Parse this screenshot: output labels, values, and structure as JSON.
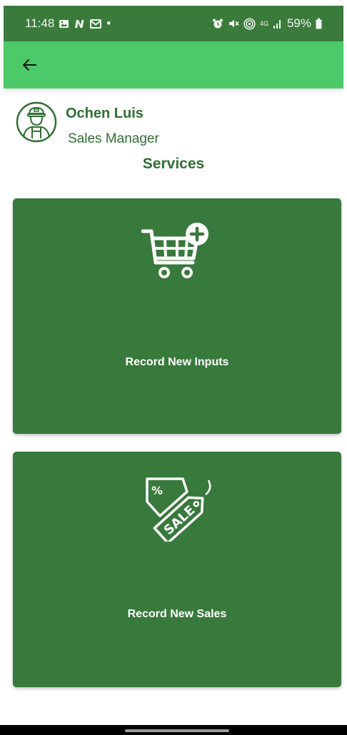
{
  "status_bar": {
    "time": "11:48",
    "dot": "•",
    "network": "4G",
    "battery": "59%"
  },
  "app_bar": {
    "back_icon": "arrow-left-icon"
  },
  "profile": {
    "name": "Ochen Luis",
    "role": "Sales Manager",
    "avatar_icon": "worker-avatar-icon"
  },
  "section": {
    "title": "Services"
  },
  "services": [
    {
      "label": "Record New Inputs",
      "icon": "cart-add-icon"
    },
    {
      "label": "Record New Sales",
      "icon": "sale-tag-icon"
    }
  ],
  "colors": {
    "status_bar": "#3a7b3c",
    "app_bar": "#4cca6a",
    "card": "#38793c",
    "text_green": "#2f6f33"
  }
}
